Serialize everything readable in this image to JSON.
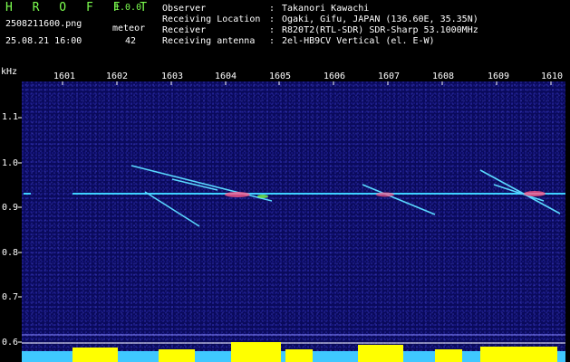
{
  "app": {
    "title": "H R O F F T",
    "version": "1.0.0"
  },
  "file": {
    "name": "2508211600.png",
    "datetime": "25.08.21 16:00"
  },
  "meteor": {
    "label": "meteor",
    "count": "42"
  },
  "info": [
    {
      "key": "Observer",
      "value": "Takanori Kawachi"
    },
    {
      "key": "Receiving Location",
      "value": "Ogaki, Gifu, JAPAN (136.60E, 35.35N)"
    },
    {
      "key": "Receiver",
      "value": "R820T2(RTL-SDR) SDR-Sharp 53.1000MHz"
    },
    {
      "key": "Receiving antenna",
      "value": "2el-HB9CV Vertical (el. E-W)"
    }
  ],
  "axes": {
    "y_unit": "kHz",
    "y_ticks": [
      "1.1",
      "1.0",
      "0.9",
      "0.8",
      "0.7",
      "0.6"
    ],
    "x_ticks": [
      "1601",
      "1602",
      "1603",
      "1604",
      "1605",
      "1606",
      "1607",
      "1608",
      "1609",
      "1610"
    ]
  },
  "colors": {
    "title": "#7CFF4F",
    "background": "#000000",
    "spectrum": "#0a0a5c",
    "carrier": "#3fd0ff",
    "bars_cyan": "#3fc8ff",
    "bars_yellow": "#ffff00"
  }
}
